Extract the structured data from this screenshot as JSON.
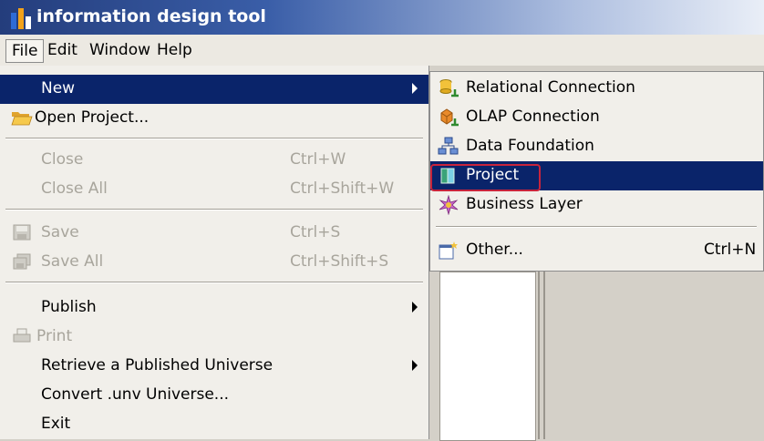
{
  "window": {
    "title": "information design tool"
  },
  "menubar": {
    "items": [
      "File",
      "Edit",
      "Window",
      "Help"
    ]
  },
  "file_menu": {
    "items": [
      {
        "label": "New",
        "shortcut": "",
        "submenu": true
      },
      {
        "label": "Open Project...",
        "shortcut": "",
        "icon": "folder-open-icon"
      },
      {
        "label": "Close",
        "shortcut": "Ctrl+W"
      },
      {
        "label": "Close All",
        "shortcut": "Ctrl+Shift+W"
      },
      {
        "label": "Save",
        "shortcut": "Ctrl+S",
        "icon": "save-icon"
      },
      {
        "label": "Save All",
        "shortcut": "Ctrl+Shift+S",
        "icon": "save-all-icon"
      },
      {
        "label": "Publish",
        "shortcut": "",
        "submenu": true
      },
      {
        "label": "Print",
        "shortcut": "",
        "icon": "print-icon"
      },
      {
        "label": "Retrieve a Published Universe",
        "shortcut": "",
        "submenu": true
      },
      {
        "label": "Convert .unv Universe...",
        "shortcut": ""
      },
      {
        "label": "Exit",
        "shortcut": ""
      }
    ]
  },
  "new_submenu": {
    "items": [
      {
        "label": "Relational Connection",
        "shortcut": "",
        "icon": "relational-connection-icon"
      },
      {
        "label": "OLAP Connection",
        "shortcut": "",
        "icon": "olap-connection-icon"
      },
      {
        "label": "Data Foundation",
        "shortcut": "",
        "icon": "data-foundation-icon"
      },
      {
        "label": "Project",
        "shortcut": "",
        "icon": "project-icon"
      },
      {
        "label": "Business Layer",
        "shortcut": "",
        "icon": "business-layer-icon"
      },
      {
        "label": "Other...",
        "shortcut": "Ctrl+N",
        "icon": "new-other-icon"
      }
    ]
  },
  "colors": {
    "highlight": "#0a246a",
    "callout": "#c8243c",
    "menu_bg": "#f1efea"
  }
}
